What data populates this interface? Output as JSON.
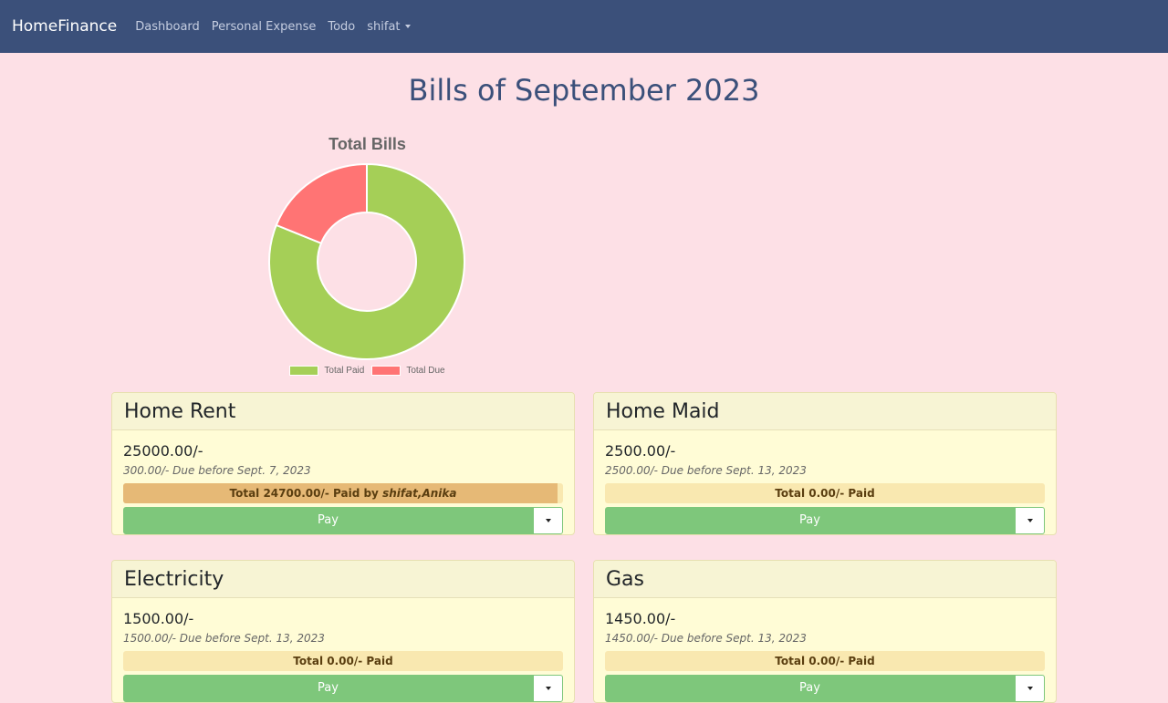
{
  "navbar": {
    "brand": "HomeFinance",
    "links": [
      "Dashboard",
      "Personal Expense",
      "Todo"
    ],
    "user": "shifat"
  },
  "page": {
    "title": "Bills of September 2023"
  },
  "chart_data": {
    "type": "pie",
    "title": "Total Bills",
    "categories": [
      "Total Paid",
      "Total Due"
    ],
    "values": [
      24700,
      5750
    ],
    "colors": [
      "#a5cf57",
      "#ff7474"
    ],
    "legend": "bottom"
  },
  "bills": [
    {
      "name": "Home Rent",
      "amount": "25000.00/-",
      "due": "300.00/- Due before Sept. 7, 2023",
      "paid_text": "Total 24700.00/- Paid by ",
      "paid_by": "shifat,Anika",
      "paid_fraction": 0.988,
      "pay_label": "Pay"
    },
    {
      "name": "Home Maid",
      "amount": "2500.00/-",
      "due": "2500.00/- Due before Sept. 13, 2023",
      "paid_text": "Total 0.00/- Paid",
      "paid_by": "",
      "paid_fraction": 0,
      "pay_label": "Pay"
    },
    {
      "name": "Electricity",
      "amount": "1500.00/-",
      "due": "1500.00/- Due before Sept. 13, 2023",
      "paid_text": "Total 0.00/- Paid",
      "paid_by": "",
      "paid_fraction": 0,
      "pay_label": "Pay"
    },
    {
      "name": "Gas",
      "amount": "1450.00/-",
      "due": "1450.00/- Due before Sept. 13, 2023",
      "paid_text": "Total 0.00/- Paid",
      "paid_by": "",
      "paid_fraction": 0,
      "pay_label": "Pay"
    }
  ]
}
